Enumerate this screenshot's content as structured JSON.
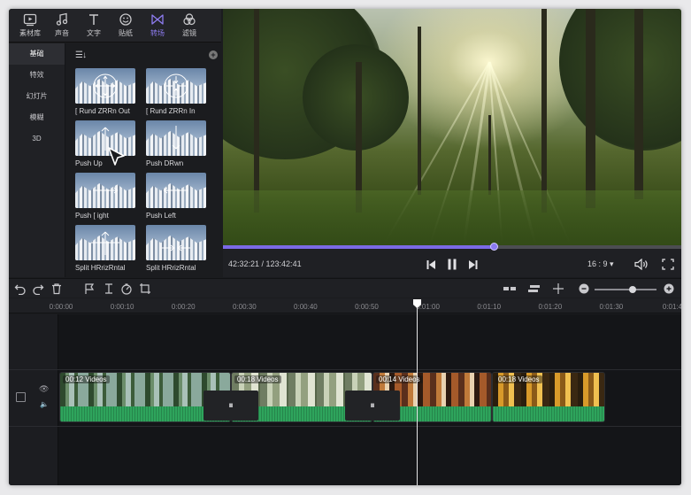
{
  "tabs": [
    {
      "label": "素材库",
      "icon": "media-library-icon"
    },
    {
      "label": "声音",
      "icon": "music-note-icon"
    },
    {
      "label": "文字",
      "icon": "text-icon"
    },
    {
      "label": "贴纸",
      "icon": "sticker-icon"
    },
    {
      "label": "转场",
      "icon": "transition-icon",
      "active": true
    },
    {
      "label": "滤镜",
      "icon": "filter-icon"
    }
  ],
  "categories": [
    "基础",
    "特效",
    "幻灯片",
    "模糊",
    "3D"
  ],
  "active_category": "基础",
  "transitions": [
    {
      "label": "[ Rund ZRRn Out"
    },
    {
      "label": "[ Rund ZRRn In"
    },
    {
      "label": "Push Up"
    },
    {
      "label": "Push DRwn"
    },
    {
      "label": "Push [ ight"
    },
    {
      "label": "Push Left"
    },
    {
      "label": "Split HRrizRntal"
    },
    {
      "label": "Split HRrizRntal"
    }
  ],
  "player": {
    "timecode": "42:32:21 / 123:42:41",
    "progress": 0.59,
    "aspect_ratio": "16 : 9",
    "aspect_caret": "▾"
  },
  "ruler": [
    "0:00:00",
    "0:00:10",
    "0:00:20",
    "0:00:30",
    "0:00:40",
    "0:00:50",
    "0:01:00",
    "0:01:10",
    "0:01:20",
    "0:01:30",
    "0:01:4"
  ],
  "zoom": 0.62,
  "clips": [
    {
      "label": "00:12  Videos"
    },
    {
      "label": "00:18  Videos"
    },
    {
      "label": "00:14  Videos"
    },
    {
      "label": "00:18  Videos"
    }
  ],
  "transition_marker": "⏸"
}
